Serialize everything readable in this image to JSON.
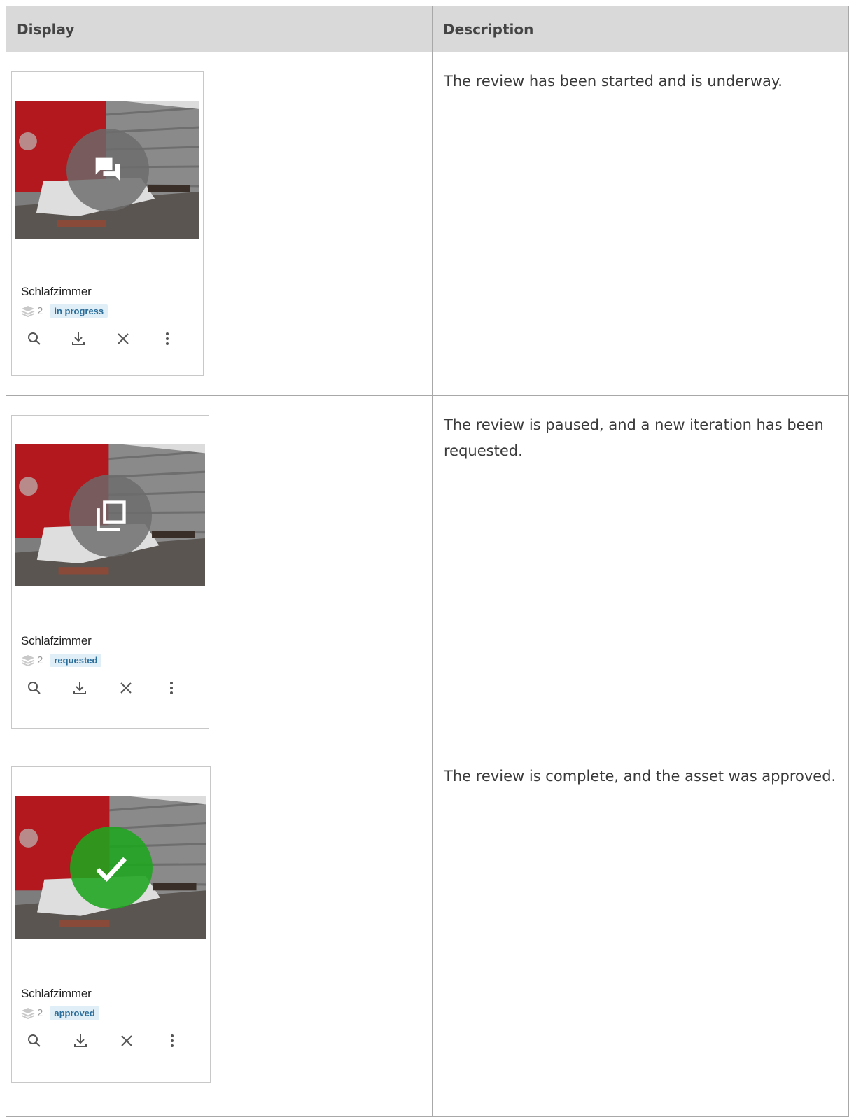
{
  "table": {
    "headers": {
      "display": "Display",
      "description": "Description"
    },
    "rows": [
      {
        "description": "The review has been started and is underway.",
        "card": {
          "name": "Schlafzimmer",
          "layer_count": "2",
          "status": "in progress",
          "overlay_icon": "chat-bubbles-icon",
          "overlay_color": "#6b6b6b"
        }
      },
      {
        "description": "The review is paused, and a new iteration has been requested.",
        "card": {
          "name": "Schlafzimmer",
          "layer_count": "2",
          "status": "requested",
          "overlay_icon": "copy-layers-icon",
          "overlay_color": "#6b6b6b"
        }
      },
      {
        "description": "The review is complete, and the asset was approved.",
        "card": {
          "name": "Schlafzimmer",
          "layer_count": "2",
          "status": "approved",
          "overlay_icon": "checkmark-icon",
          "overlay_color": "#1ea51e"
        }
      }
    ]
  },
  "card_actions": [
    "search-icon",
    "download-icon",
    "close-icon",
    "more-vertical-icon"
  ],
  "colors": {
    "header_bg": "#d9d9d9",
    "badge_bg": "#e0eff7",
    "badge_text": "#2a6d9a",
    "approved_green": "#1ea51e"
  }
}
